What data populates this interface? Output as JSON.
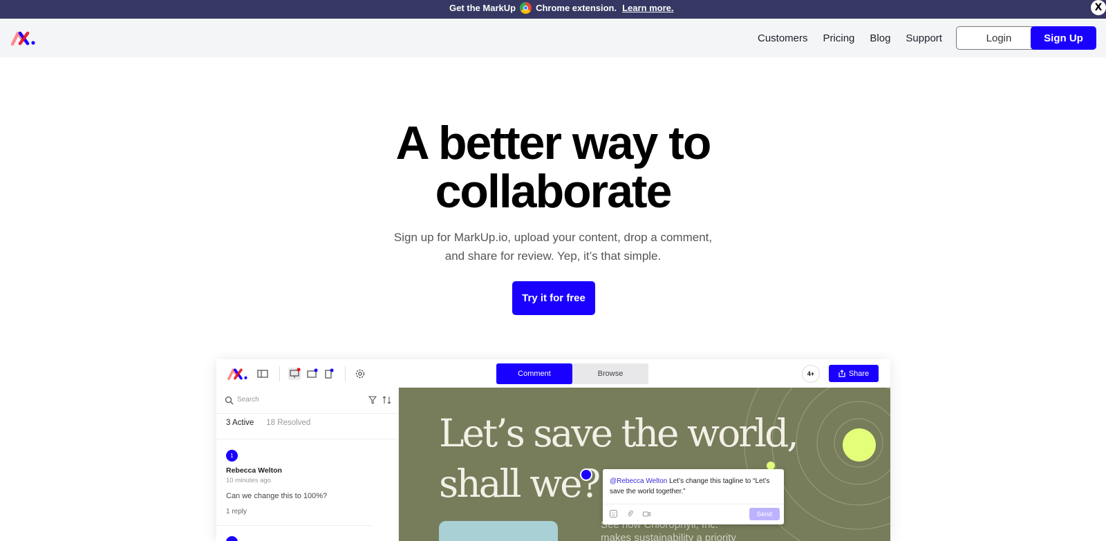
{
  "banner": {
    "prefix": "Get the MarkUp",
    "suffix": "Chrome extension.",
    "link": "Learn more.",
    "close": "X"
  },
  "nav": {
    "links": [
      "Customers",
      "Pricing",
      "Blog",
      "Support"
    ],
    "login": "Login",
    "signup": "Sign Up"
  },
  "hero": {
    "title_line1": "A better way to",
    "title_line2": "collaborate",
    "subtitle_line1": "Sign up for MarkUp.io, upload your content, drop a comment,",
    "subtitle_line2": "and share for review. Yep, it’s that simple.",
    "cta": "Try it for free"
  },
  "app": {
    "segments": {
      "comment": "Comment",
      "browse": "Browse"
    },
    "avatar_more": "4+",
    "share": "Share",
    "search_placeholder": "Search",
    "tabs": {
      "active": "3 Active",
      "resolved": "18 Resolved"
    },
    "comment": {
      "number": "1",
      "author": "Rebecca Welton",
      "time": "10 minutes ago",
      "text": "Can we change this to 100%?",
      "replies": "1 reply"
    },
    "canvas": {
      "headline_line1": "Let’s save the world,",
      "headline_line2": "shall we?",
      "body_line1": "See how Chlorophyll, Inc.",
      "body_line2": "makes sustainability a priority"
    },
    "popup": {
      "mention": "@Rebecca Welton",
      "text": " Let’s change this tagline to “Let’s save the world together.”",
      "send": "Send"
    }
  },
  "colors": {
    "brand_blue": "#1a00ff",
    "banner_bg": "#363863",
    "canvas_olive": "#777c5b",
    "accent_lime": "#e3ff7a"
  }
}
